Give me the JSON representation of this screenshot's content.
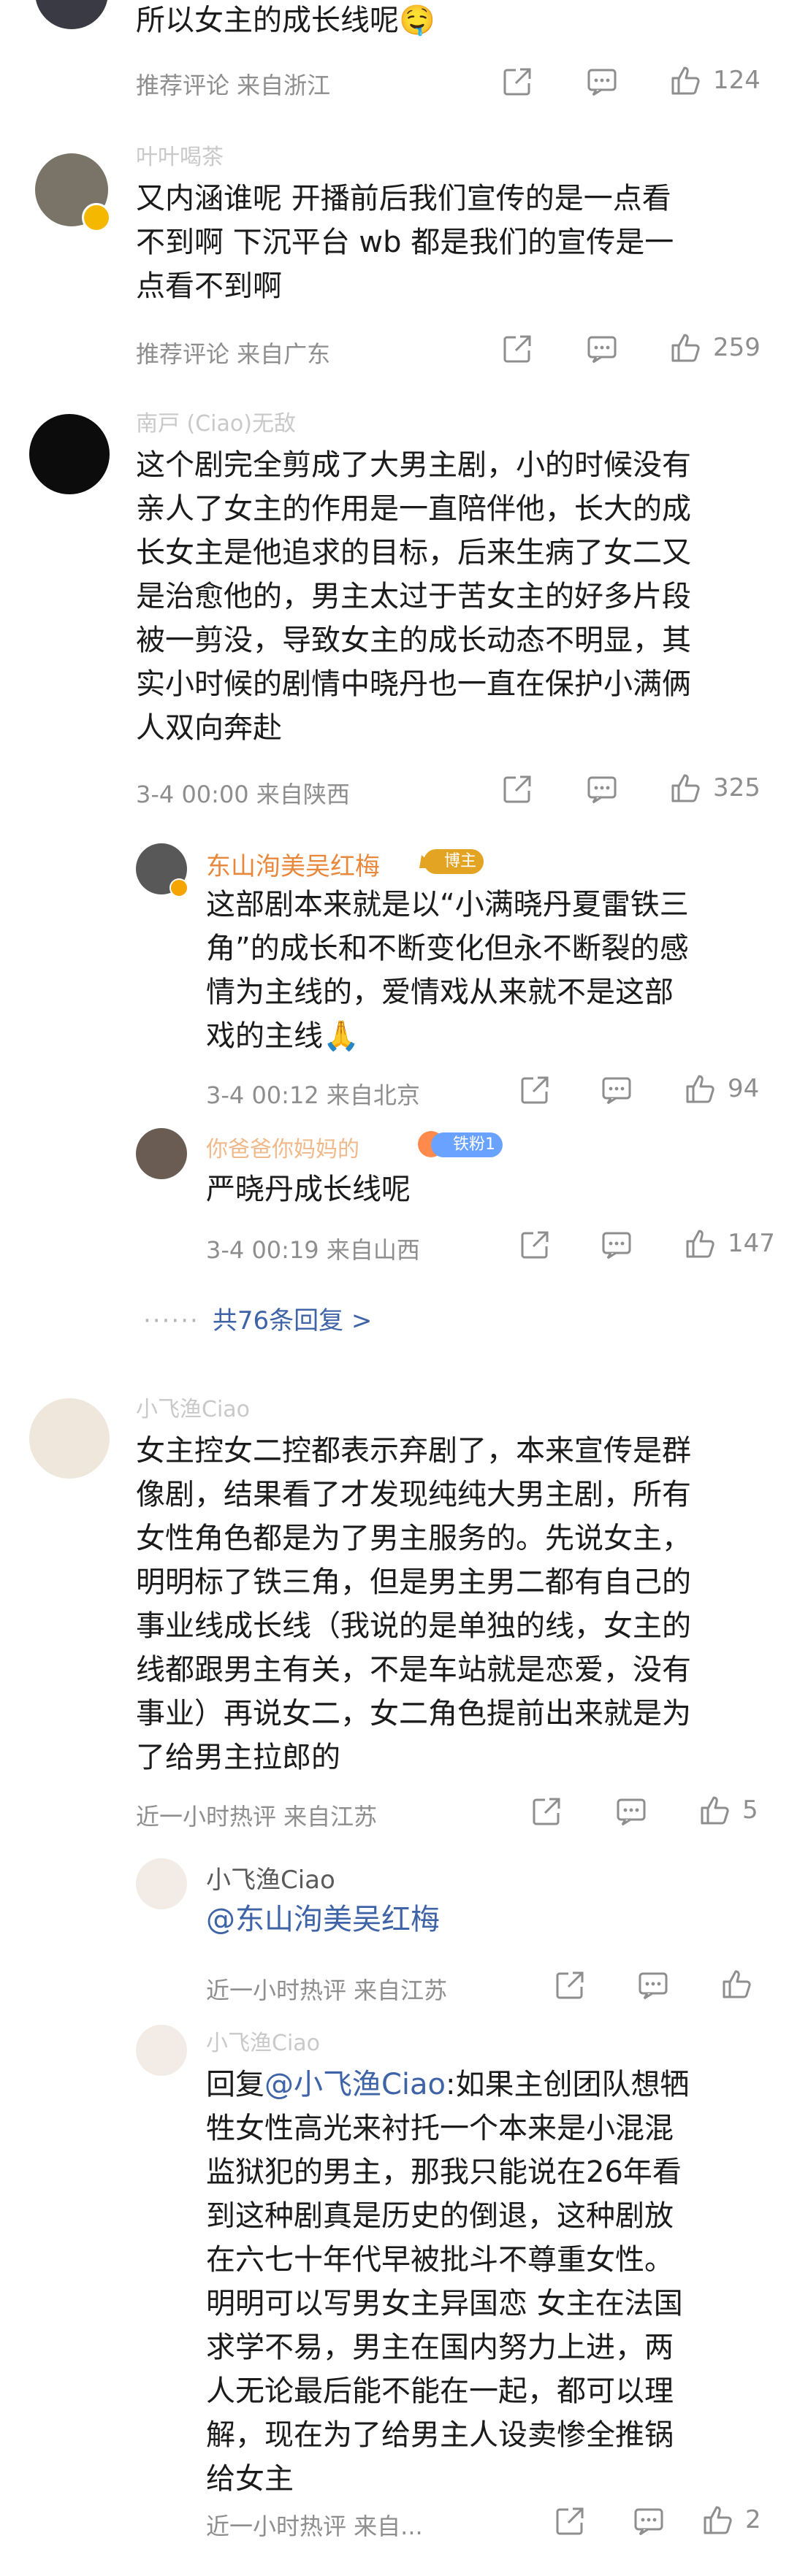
{
  "comments": [
    {
      "text": "所以女主的成长线呢🤤",
      "meta": "推荐评论  来自浙江",
      "likes": "124"
    },
    {
      "username": "叶叶喝茶",
      "text": "又内涵谁呢 开播前后我们宣传的是一点看\n不到啊 下沉平台 wb 都是我们的宣传是一\n点看不到啊",
      "meta": "推荐评论  来自广东",
      "likes": "259"
    },
    {
      "username": "南戸 (Ciao)无敌",
      "text": "这个剧完全剪成了大男主剧，小的时候没有\n亲人了女主的作用是一直陪伴他，长大的成\n长女主是他追求的目标，后来生病了女二又\n是治愈他的，男主太过于苦女主的好多片段\n被一剪没，导致女主的成长动态不明显，其\n实小时候的剧情中晓丹也一直在保护小满俩\n人双向奔赴",
      "meta": "3-4 00:00  来自陕西",
      "likes": "325",
      "replies": [
        {
          "username": "东山洵美吴红梅",
          "badge": "博主",
          "text": "这部剧本来就是以“小满晓丹夏雷铁三\n角”的成长和不断变化但永不断裂的感\n情为主线的，爱情戏从来就不是这部\n戏的主线🙏",
          "meta": "3-4 00:12  来自北京",
          "likes": "94"
        },
        {
          "username": "你爸爸你妈妈的",
          "badge": "铁粉1",
          "text": "严晓丹成长线呢",
          "meta": "3-4 00:19  来自山西",
          "likes": "147"
        }
      ],
      "more_replies": "共76条回复 >"
    },
    {
      "username": "小飞渔Ciao",
      "text": "女主控女二控都表示弃剧了，本来宣传是群\n像剧，结果看了才发现纯纯大男主剧，所有\n女性角色都是为了男主服务的。先说女主，\n明明标了铁三角，但是男主男二都有自己的\n事业线成长线（我说的是单独的线，女主的\n线都跟男主有关，不是车站就是恋爱，没有\n事业）再说女二，女二角色提前出来就是为\n了给男主拉郎的",
      "meta": "近一小时热评  来自江苏",
      "likes": "5",
      "replies": [
        {
          "username": "小飞渔Ciao",
          "text": "@东山洵美吴红梅",
          "meta": "近一小时热评  来自江苏",
          "likes": ""
        },
        {
          "username": "小飞渔Ciao",
          "reply_prefix": "回复",
          "mention": "@小飞渔Ciao",
          "text": ":如果主创团队想牺\n牲女性高光来衬托一个本来是小混混\n监狱犯的男主，那我只能说在26年看\n到这种剧真是历史的倒退，这种剧放\n在六七十年代早被批斗不尊重女性。\n明明可以写男女主异国恋 女主在法国\n求学不易，男主在国内努力上进，两\n人无论最后能不能在一起，都可以理\n解，现在为了给男主人设卖惨全推锅\n给女主",
          "meta": "近一小时热评  来自...",
          "likes": "2"
        }
      ]
    }
  ],
  "icons": [
    "share-icon",
    "comment-icon",
    "like-icon"
  ],
  "colors": {
    "link": "#3e63a6",
    "meta": "#8e8e8e",
    "text": "#1b1b1b",
    "badge_gold": "#e3a323",
    "badge_fan": "#6aa3ff"
  }
}
